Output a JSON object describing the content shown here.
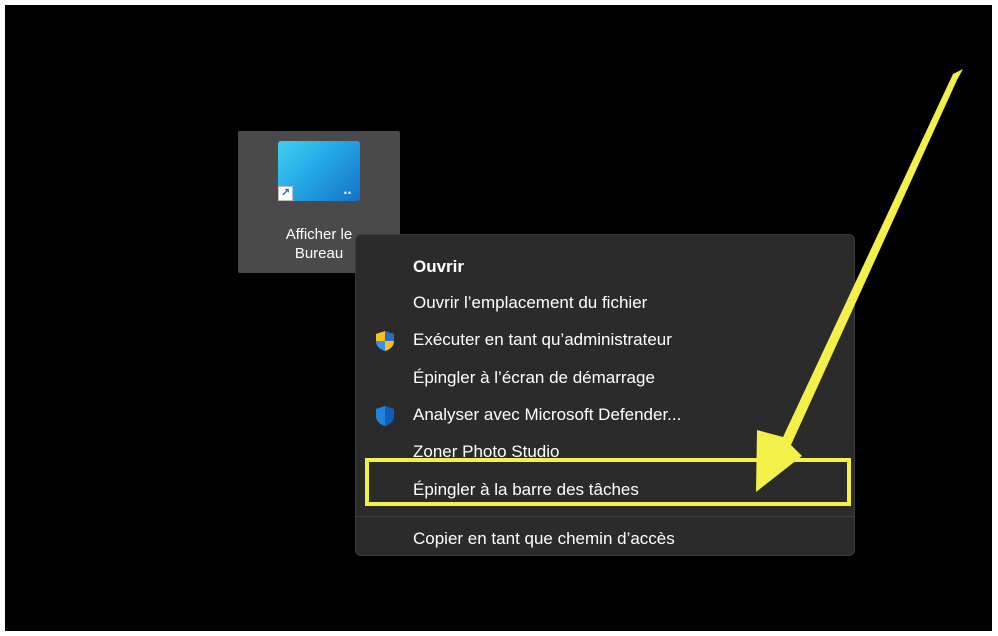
{
  "desktop_icon": {
    "label_line1": "Afficher le",
    "label_line2": "Bureau",
    "icon": "desktop-shortcut-icon",
    "badge": "shortcut-arrow-icon"
  },
  "context_menu": {
    "items": [
      {
        "label": "Ouvrir",
        "bold": true,
        "icon": null
      },
      {
        "label": "Ouvrir l’emplacement du fichier",
        "icon": null
      },
      {
        "label": "Exécuter en tant qu’administrateur",
        "icon": "uac-shield-icon"
      },
      {
        "label": "Épingler à l’écran de démarrage",
        "icon": null
      },
      {
        "label": "Analyser avec Microsoft Defender...",
        "icon": "defender-shield-icon"
      },
      {
        "label": "Zoner Photo Studio",
        "icon": null
      },
      {
        "label": "Épingler à la barre des tâches",
        "icon": null,
        "highlighted": true
      },
      {
        "label": "Copier en tant que chemin d’accès",
        "icon": null
      }
    ]
  },
  "annotation": {
    "color": "#f4f04a",
    "arrow": "yellow-arrow-icon"
  },
  "colors": {
    "background": "#000000",
    "menu_background": "#2b2b2b",
    "icon_selection": "#4a4a4a",
    "highlight": "#f4f04a"
  }
}
